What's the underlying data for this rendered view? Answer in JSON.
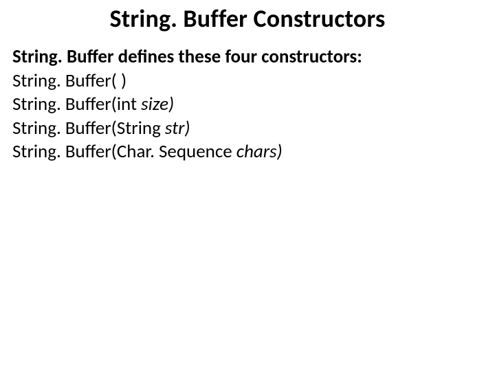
{
  "title": "String. Buffer Constructors",
  "intro": "String. Buffer defines these four constructors:",
  "constructors": [
    {
      "plain": "String. Buffer( )",
      "ital": ""
    },
    {
      "plain": "String. Buffer(int ",
      "ital": "size)"
    },
    {
      "plain": "String. Buffer(String ",
      "ital": "str)"
    },
    {
      "plain": "String. Buffer(Char. Sequence ",
      "ital": "chars)"
    }
  ]
}
